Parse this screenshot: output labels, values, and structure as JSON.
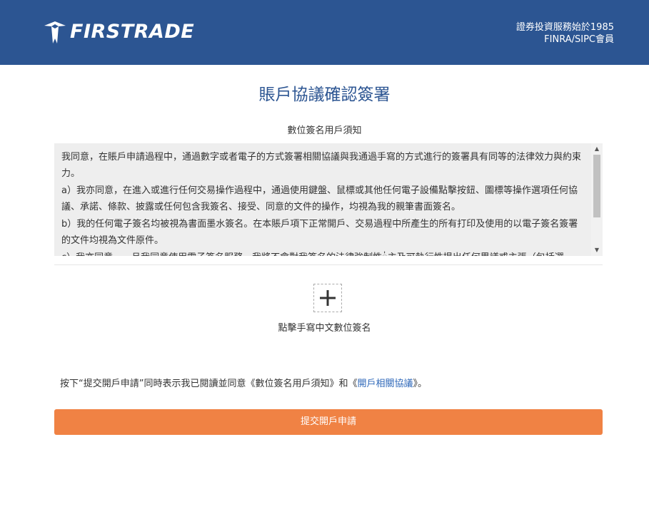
{
  "header": {
    "logo_text": "FIRSTRADE",
    "tagline_line1": "證券投資服務始於1985",
    "tagline_line2": "FINRA/SIPC會員"
  },
  "page_title": "賬戶協議確認簽署",
  "notice": {
    "title": "數位簽名用戶須知",
    "paragraphs": [
      "我同意，在賬戶申請過程中，通過數字或者電子的方式簽署相關協議與我通過手寫的方式進行的簽署具有同等的法律效力與約束力。",
      "a）我亦同意，在進入或進行任何交易操作過程中，通過使用鍵盤、鼠標或其他任何電子設備點擊按鈕、圖標等操作選項任何協議、承諾、條款、披露或任何包含我簽名、接受、同意的文件的操作，均視為我的親筆書面簽名。",
      "b）我的任何電子簽名均被視為書面墨水簽名。在本賬戶項下正常開戶、交易過程中所產生的所有打印及使用的以電子簽名簽署的文件均視為文件原件。",
      "c）我亦同意，一旦我同意使用電子簽名服務，我將不會對我簽名的法律強制性់主及可執行性提出任何異議或主張（包括選"
    ]
  },
  "signature": {
    "label": "點擊手寫中文數位簽名"
  },
  "agreement": {
    "prefix": "按下“提交開戶申請”同時表示我已閱讀並同意《數位簽名用戶須知》和《",
    "link": "開戶相關協議",
    "suffix": "》。"
  },
  "submit_label": "提交開戶申請",
  "colors": {
    "header_bg": "#2c5592",
    "title": "#2c5592",
    "submit_bg": "#f08244",
    "link": "#2c66b8"
  }
}
